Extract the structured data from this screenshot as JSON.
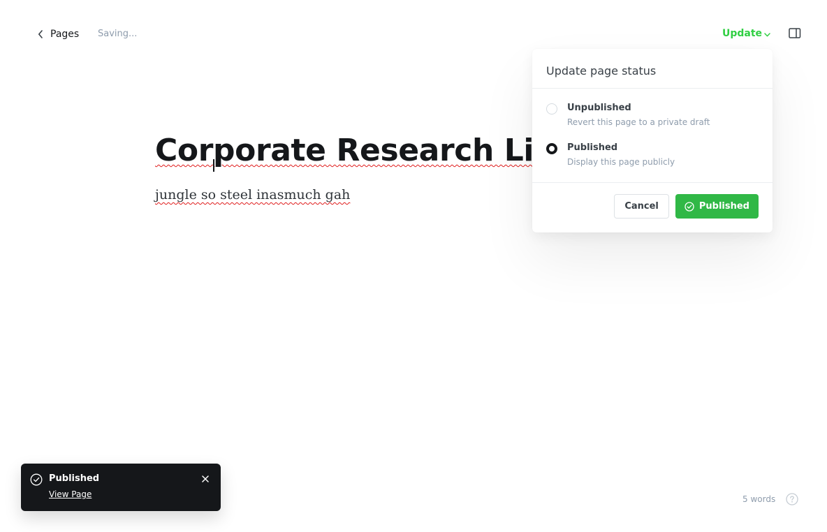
{
  "topbar": {
    "back_label": "Pages",
    "status": "Saving...",
    "update_label": "Update"
  },
  "editor": {
    "title": "Corporate Research Liaison",
    "body": "jungle so steel inasmuch gah"
  },
  "popover": {
    "title": "Update page status",
    "options": [
      {
        "label": "Unpublished",
        "description": "Revert this page to a private draft",
        "selected": false
      },
      {
        "label": "Published",
        "description": "Display this page publicly",
        "selected": true
      }
    ],
    "cancel_label": "Cancel",
    "confirm_label": "Published"
  },
  "toast": {
    "title": "Published",
    "link_label": "View Page"
  },
  "footer": {
    "word_count": "5 words"
  },
  "icons": {
    "back": "chevron-left-icon",
    "update": "chevron-down-icon",
    "sidebar": "sidebar-toggle-icon",
    "confirm": "check-circle-icon",
    "toast": "check-circle-icon",
    "close": "close-icon",
    "help": "question-circle-icon"
  },
  "colors": {
    "accent_green": "#30cf43",
    "button_green": "#30b846",
    "toast_bg": "#15171a",
    "spell_underline": "#e01b1b"
  }
}
